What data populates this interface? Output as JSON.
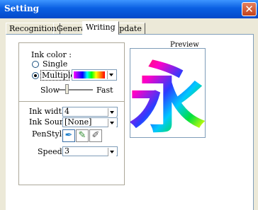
{
  "window": {
    "title": "Setting",
    "close_label": "✕"
  },
  "tabs": [
    {
      "label": "Recognition"
    },
    {
      "label": "General"
    },
    {
      "label": "Writing"
    },
    {
      "label": "Update"
    }
  ],
  "ink_color": {
    "heading": "Ink color :",
    "single_label": "Single",
    "multiple_label": "Multiple",
    "selected": "Multiple",
    "slider_min_label": "Slow",
    "slider_max_label": "Fast",
    "speed_level": 0.2
  },
  "settings": {
    "ink_width_label": "Ink width :",
    "ink_width_value": "4",
    "ink_sound_label": "Ink Sound :",
    "ink_sound_value": "[None]",
    "pen_style_label": "PenStyle :",
    "speed_label": "Speed :",
    "speed_value": "3"
  },
  "preview": {
    "label": "Preview",
    "character": "永"
  },
  "icons": [
    "close-icon",
    "pen-brush-icon",
    "pen-calligraphy-icon",
    "pen-fine-icon",
    "chevron-down-icon"
  ]
}
